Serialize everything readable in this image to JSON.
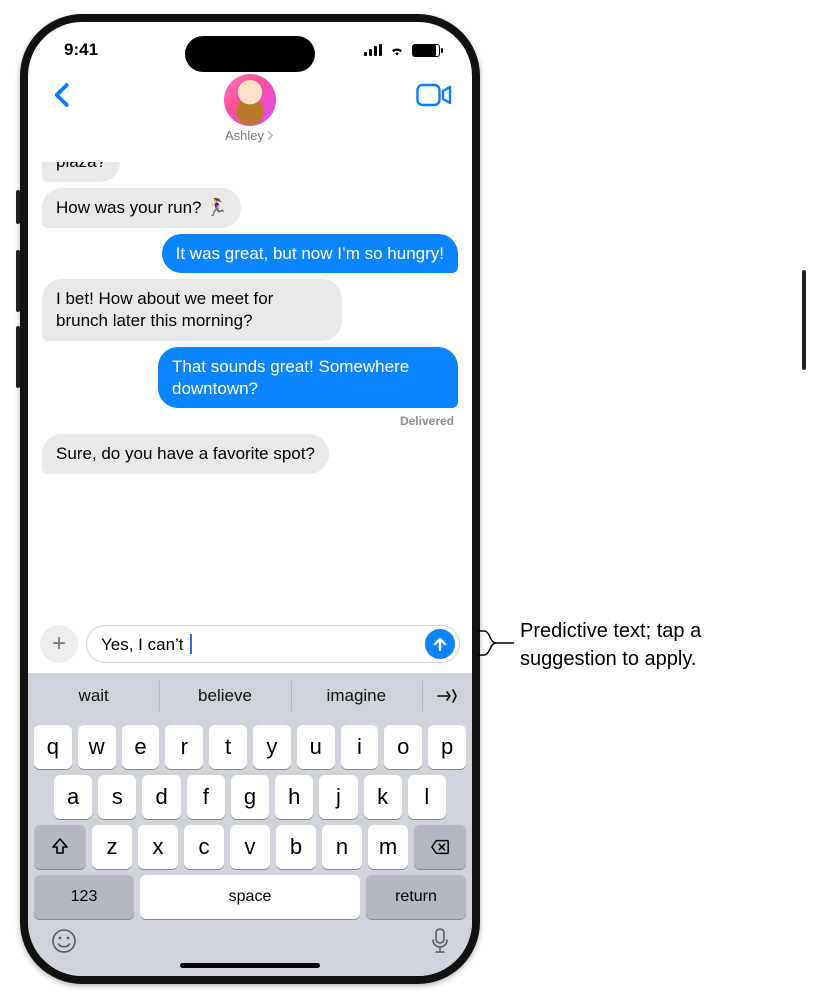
{
  "status": {
    "time": "9:41"
  },
  "contact": {
    "name": "Ashley"
  },
  "messages": {
    "m0": "plaza?",
    "m1": "How was your run? 🏃‍♀️",
    "m2": "It was great, but now I’m so hungry!",
    "m3": "I bet! How about we meet for brunch later this morning?",
    "m4": "That sounds great! Somewhere downtown?",
    "receipt": "Delivered",
    "m5": "Sure, do you have a favorite spot?"
  },
  "compose": {
    "text": "Yes, I can’t "
  },
  "predictions": {
    "p1": "wait",
    "p2": "believe",
    "p3": "imagine"
  },
  "keys": {
    "row1": [
      "q",
      "w",
      "e",
      "r",
      "t",
      "y",
      "u",
      "i",
      "o",
      "p"
    ],
    "row2": [
      "a",
      "s",
      "d",
      "f",
      "g",
      "h",
      "j",
      "k",
      "l"
    ],
    "row3": [
      "z",
      "x",
      "c",
      "v",
      "b",
      "n",
      "m"
    ],
    "numbers": "123",
    "space": "space",
    "return": "return"
  },
  "callout": "Predictive text; tap a suggestion to apply."
}
